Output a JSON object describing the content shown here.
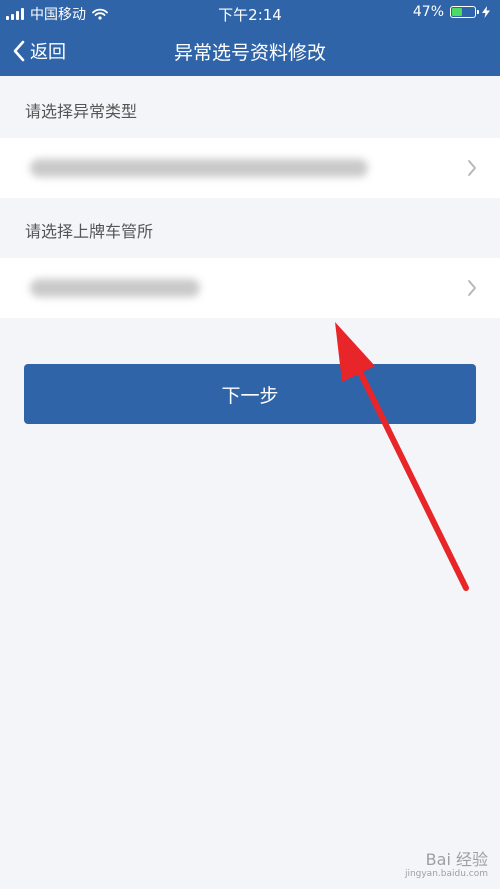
{
  "status_bar": {
    "carrier": "中国移动",
    "time": "下午2:14",
    "battery_percent_text": "47%",
    "battery_level": 0.47,
    "icons": [
      "signal-bars-icon",
      "wifi-icon",
      "battery-icon",
      "charging-bolt-icon"
    ]
  },
  "nav": {
    "back_label": "返回",
    "title": "异常选号资料修改"
  },
  "form": {
    "section1_label": "请选择异常类型",
    "section1_value": "",
    "section2_label": "请选择上牌车管所",
    "section2_value": ""
  },
  "next_button_label": "下一步",
  "watermark": {
    "text": "Bai 经验",
    "sub": "jingyan.baidu.com"
  },
  "colors": {
    "header_blue": "#2f64a8",
    "background": "#f3f5f8",
    "annotation_arrow": "#e8262a"
  }
}
